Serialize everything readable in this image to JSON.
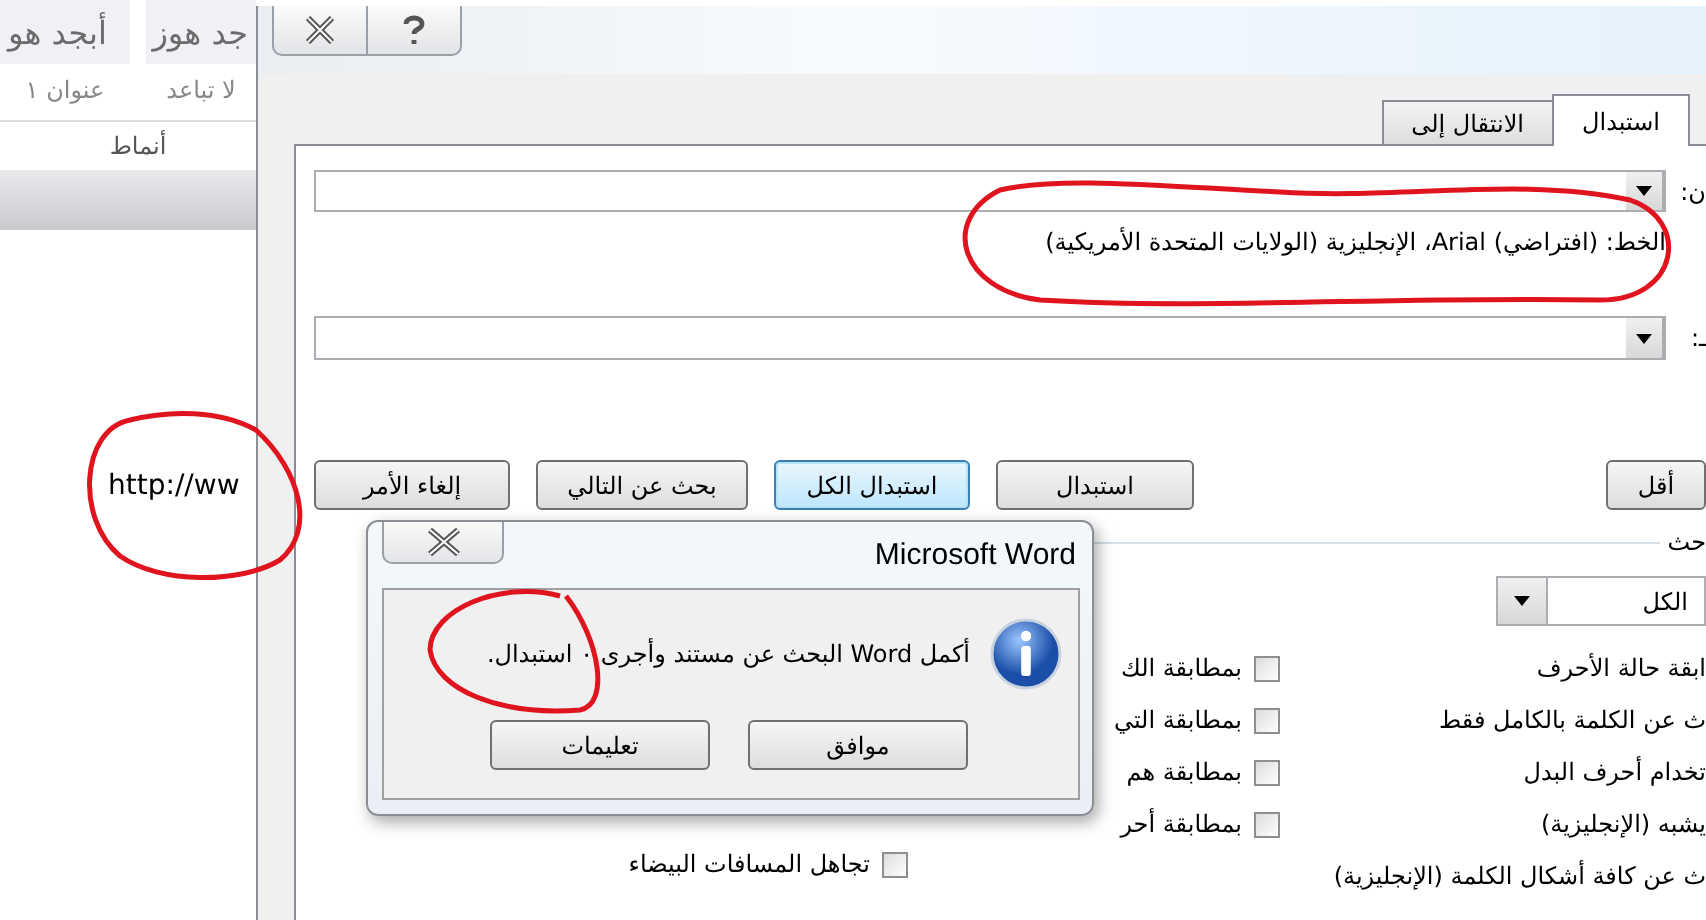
{
  "document": {
    "styles": [
      {
        "sample": "جد هوز",
        "name": "لا تباعد"
      },
      {
        "sample": "أبجد هو",
        "name": "عنوان ١"
      }
    ],
    "group_label": "أنماط",
    "body_text": "http://ww"
  },
  "dialog": {
    "tabs": [
      {
        "label": "استبدال",
        "selected": true
      },
      {
        "label": "الانتقال إلى",
        "selected": false
      }
    ],
    "find_label": "ن:",
    "format_text": "الخط: (افتراضي) Arial، الإنجليزية (الولايات المتحدة الأمريكية)",
    "replace_label": "ـ:",
    "less_button": "أقل",
    "buttons": [
      {
        "label": "استبدال",
        "focused": false
      },
      {
        "label": "استبدال الكل",
        "focused": true
      },
      {
        "label": "بحث عن التالي",
        "focused": false
      },
      {
        "label": "إلغاء الأمر",
        "focused": false
      }
    ],
    "search_group": "حث",
    "search_scope": "الكل",
    "options_right": [
      "ابقة حالة الأحرف",
      "ث عن الكلمة بالكامل فقط",
      "تخدام أحرف البدل",
      "يشبه (الإنجليزية)",
      "ث عن كافة أشكال الكلمة (الإنجليزية)"
    ],
    "options_left": [
      {
        "label": "بمطابقة الك",
        "checked": false
      },
      {
        "label": "بمطابقة التي",
        "checked": false
      },
      {
        "label": "بمطابقة هم",
        "checked": false
      },
      {
        "label": "بمطابقة أحر",
        "checked": false
      }
    ],
    "options_left2": [
      {
        "label": "تجاهل المسافات البيضاء",
        "checked": false
      }
    ]
  },
  "message_box": {
    "title": "Microsoft Word",
    "text": "أكمل Word البحث عن مستند وأجرى ٠ استبدال.",
    "buttons": [
      {
        "label": "موافق"
      },
      {
        "label": "تعليمات"
      }
    ]
  }
}
